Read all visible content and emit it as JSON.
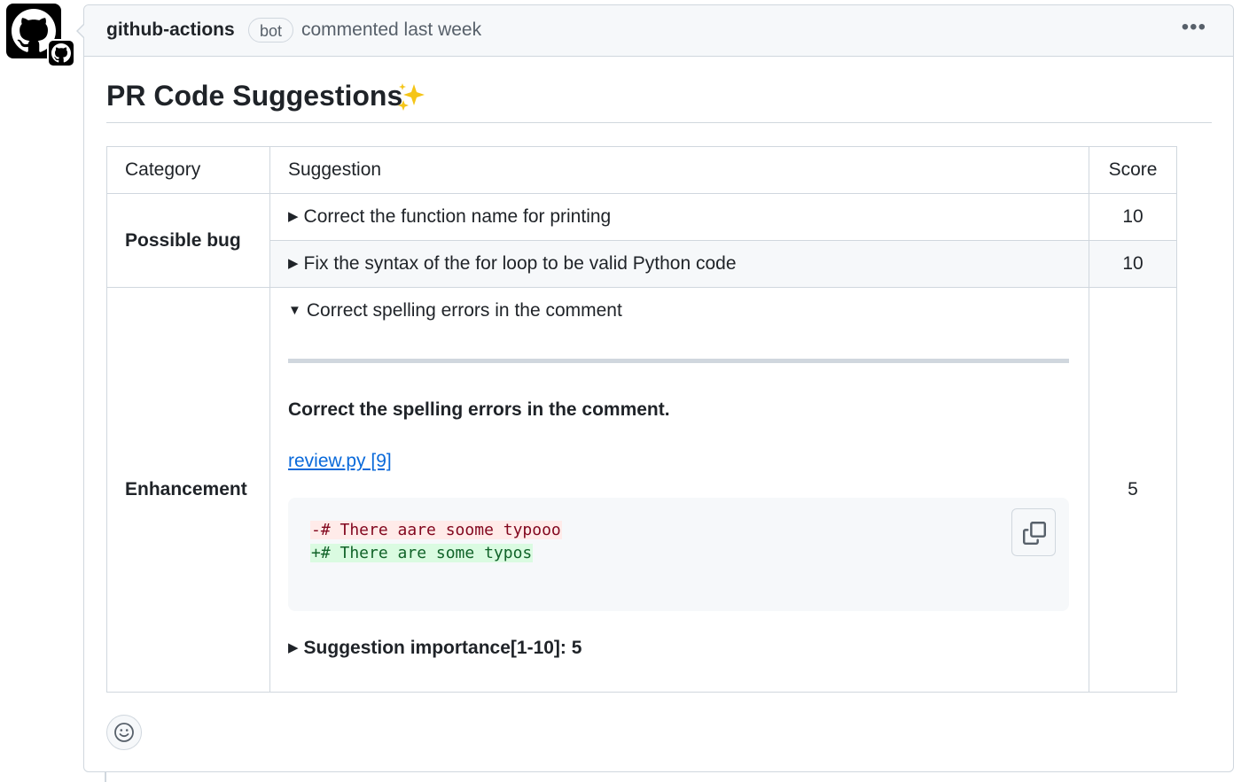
{
  "avatar": {
    "icon": "github-octocat-icon",
    "badge_icon": "github-actions-badge-icon"
  },
  "header": {
    "author": "github-actions",
    "bot_label": "bot",
    "commented_text": "commented last week",
    "menu_icon": "kebab-icon"
  },
  "body": {
    "title": "PR Code Suggestions",
    "title_emoji": "sparkles-icon"
  },
  "table": {
    "headers": {
      "category": "Category",
      "suggestion": "Suggestion",
      "score": "Score"
    },
    "rows": [
      {
        "category": "Possible bug",
        "suggestion": "Correct the function name for printing",
        "score": "10",
        "expanded": false
      },
      {
        "category": "",
        "suggestion": "Fix the syntax of the for loop to be valid Python code",
        "score": "10",
        "expanded": false
      },
      {
        "category": "Enhancement",
        "suggestion": "Correct spelling errors in the comment",
        "score": "5",
        "expanded": true
      }
    ],
    "expanded": {
      "description": "Correct the spelling errors in the comment.",
      "file_link": "review.py [9]",
      "code_removed": "-# There aare soome typooo",
      "code_added": "+# There are some typos",
      "importance_label": "Suggestion importance[1-10]: 5"
    }
  },
  "colors": {
    "link": "#0969da",
    "removed_bg": "#ffebe9",
    "added_bg": "#dafbe1",
    "border": "#d0d7de"
  }
}
